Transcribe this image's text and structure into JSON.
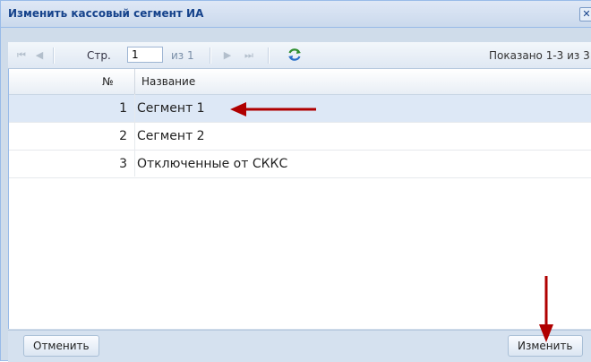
{
  "dialog": {
    "title": "Изменить кассовый сегмент ИА",
    "close_icon": "close-icon"
  },
  "toolbar": {
    "page_label": "Стр.",
    "page_value": "1",
    "of_label": "из 1",
    "showing": "Показано 1-3 из 3"
  },
  "grid": {
    "columns": [
      "№",
      "Название"
    ],
    "rows": [
      {
        "num": "1",
        "name": "Сегмент 1"
      },
      {
        "num": "2",
        "name": "Сегмент 2"
      },
      {
        "num": "3",
        "name": "Отключенные от СККС"
      }
    ]
  },
  "footer": {
    "cancel_label": "Отменить",
    "change_label": "Изменить"
  },
  "colors": {
    "accent": "#15428b",
    "arrow": "#c00000",
    "selected_row": "#dde8f6"
  }
}
